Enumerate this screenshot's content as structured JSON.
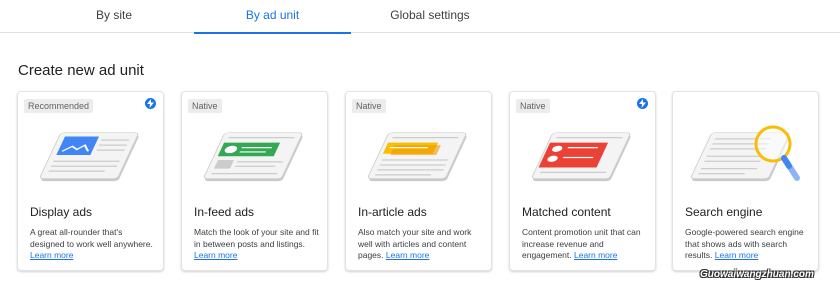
{
  "tabs": [
    {
      "label": "By site"
    },
    {
      "label": "By ad unit",
      "active": true
    },
    {
      "label": "Global settings"
    }
  ],
  "section_title": "Create new ad unit",
  "cards": [
    {
      "badge": "Recommended",
      "has_bolt": true,
      "title": "Display ads",
      "description": "A great all-rounder that's designed to work well anywhere.",
      "link": "Learn more",
      "illustration": "display-ads-illustration",
      "accent": "#4285f4"
    },
    {
      "badge": "Native",
      "has_bolt": false,
      "title": "In-feed ads",
      "description": "Match the look of your site and fit in between posts and listings.",
      "link": "Learn more",
      "illustration": "in-feed-ads-illustration",
      "accent": "#34a853"
    },
    {
      "badge": "Native",
      "has_bolt": false,
      "title": "In-article ads",
      "description": "Also match your site and work well with articles and content pages.",
      "link": "Learn more",
      "illustration": "in-article-ads-illustration",
      "accent": "#fbbc04"
    },
    {
      "badge": "Native",
      "has_bolt": true,
      "title": "Matched content",
      "description": "Content promotion unit that can increase revenue and engagement.",
      "link": "Learn more",
      "illustration": "matched-content-illustration",
      "accent": "#ea4335"
    },
    {
      "badge": "",
      "has_bolt": false,
      "title": "Search engine",
      "description": "Google-powered search engine that shows ads with search results.",
      "link": "Learn more",
      "illustration": "search-engine-illustration",
      "accent": "#fbbc04"
    }
  ],
  "watermark": "Guowaiwangzhuan.com",
  "colors": {
    "link": "#1a73e8",
    "active_tab": "#1a73e8",
    "bolt": "#1a73e8"
  }
}
